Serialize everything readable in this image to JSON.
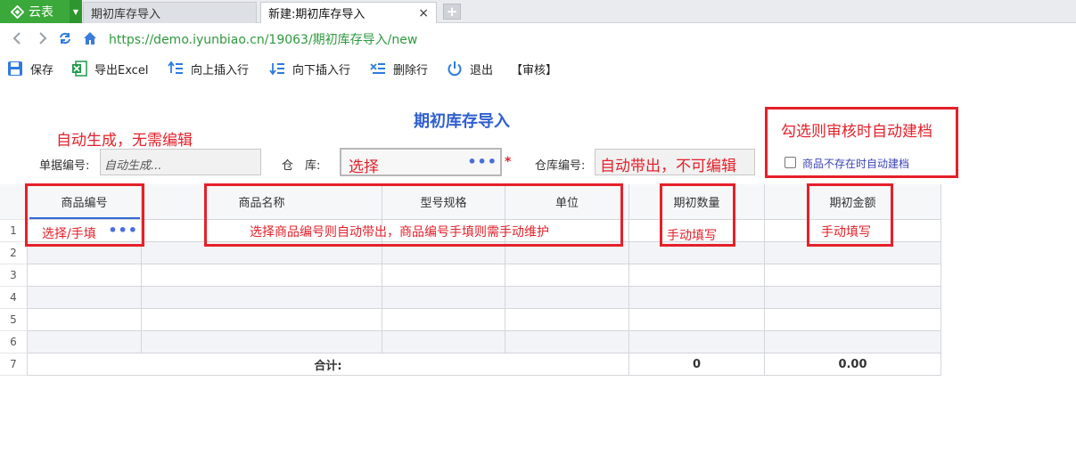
{
  "tabs": {
    "brand": "云表",
    "inactive_tab": "期初库存导入",
    "active_tab": "新建:期初库存导入",
    "close_glyph": "×",
    "new_tab_glyph": "+"
  },
  "address": {
    "url": "https://demo.iyunbiao.cn/19063/期初库存导入/new"
  },
  "toolbar": {
    "save": "保存",
    "export_excel": "导出Excel",
    "insert_above": "向上插入行",
    "insert_below": "向下插入行",
    "delete_row": "删除行",
    "exit": "退出",
    "audit": "【审核】"
  },
  "form": {
    "title": "期初库存导入",
    "doc_no_label": "单据编号:",
    "doc_no_placeholder": "自动生成...",
    "warehouse_label": "仓　库:",
    "warehouse_value": "选择",
    "warehouse_dots": "•••",
    "required_mark": "*",
    "warehouse_code_label": "仓库编号:",
    "warehouse_code_value": "自动带出，不可编辑",
    "auto_archive_label": "商品不存在时自动建档",
    "auto_archive_checked": false
  },
  "annotations": {
    "auto_generated": "自动生成，无需编辑",
    "check_hint": "勾选则审核时自动建档",
    "product_code_hint": "选择/手填",
    "product_name_hint": "选择商品编号则自动带出，商品编号手填则需手动维护",
    "qty_hint": "手动填写",
    "amount_hint": "手动填写"
  },
  "grid": {
    "headers": [
      "商品编号",
      "商品名称",
      "型号规格",
      "单位",
      "期初数量",
      "期初金额"
    ],
    "row_numbers": [
      "1",
      "2",
      "3",
      "4",
      "5",
      "6",
      "7"
    ],
    "first_row_dots": "•••",
    "total_label": "合计:",
    "total_qty": "0",
    "total_amount": "0.00"
  },
  "colors": {
    "brand_green": "#3aa83a",
    "title_blue": "#2f5fd0",
    "annotation_red": "#e5202a",
    "url_green": "#2e9a3e"
  }
}
